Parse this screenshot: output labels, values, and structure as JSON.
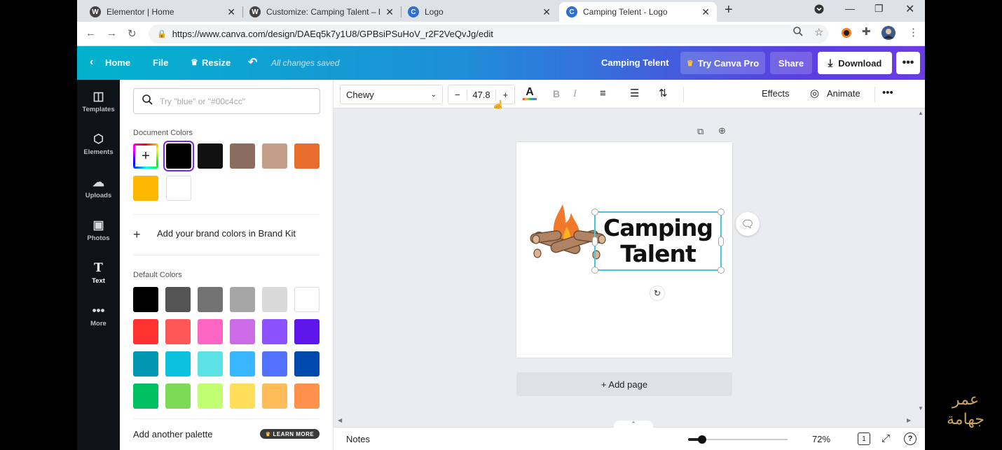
{
  "browser": {
    "tabs": [
      {
        "label": "Elementor | Home",
        "icon": "wordpress-icon"
      },
      {
        "label": "Customize: Camping Talent – Eve",
        "icon": "wordpress-icon"
      },
      {
        "label": "Logo",
        "icon": "canva-icon"
      },
      {
        "label": "Camping Telent - Logo",
        "icon": "canva-icon"
      }
    ],
    "url": "https://www.canva.com/design/DAEq5k7y1U8/GPBsiPSuHoV_r2F2VeQvJg/edit"
  },
  "topbar": {
    "home": "Home",
    "file": "File",
    "resize": "Resize",
    "status": "All changes saved",
    "design_title": "Camping Telent",
    "try_pro": "Try Canva Pro",
    "share": "Share",
    "download": "Download"
  },
  "leftnav": [
    {
      "label": "Templates",
      "icon": "templates-icon"
    },
    {
      "label": "Elements",
      "icon": "elements-icon"
    },
    {
      "label": "Uploads",
      "icon": "uploads-icon"
    },
    {
      "label": "Photos",
      "icon": "photos-icon"
    },
    {
      "label": "Text",
      "icon": "text-icon"
    },
    {
      "label": "More",
      "icon": "more-icon"
    }
  ],
  "panel": {
    "search_placeholder": "Try \"blue\" or \"#00c4cc\"",
    "document_colors_title": "Document Colors",
    "document_colors": [
      "#000000",
      "#111111",
      "#8a6d5e",
      "#c49e86",
      "#e86c2c",
      "#ffb703",
      "#ffffff"
    ],
    "brand_kit": "Add your brand colors in Brand Kit",
    "default_colors_title": "Default Colors",
    "default_colors": [
      [
        "#000000",
        "#545454",
        "#737373",
        "#a6a6a6",
        "#d9d9d9",
        "#ffffff"
      ],
      [
        "#ff3131",
        "#ff5757",
        "#ff66c4",
        "#cb6ce6",
        "#8c52ff",
        "#5e17eb"
      ],
      [
        "#0097b2",
        "#0cc0df",
        "#5ce1e6",
        "#38b6ff",
        "#5271ff",
        "#004aad"
      ],
      [
        "#00bf63",
        "#7ed957",
        "#c1ff72",
        "#ffde59",
        "#ffbd59",
        "#ff914d"
      ]
    ],
    "add_palette": "Add another palette",
    "learn_more": "LEARN MORE"
  },
  "toolbar": {
    "font": "Chewy",
    "size": "47.8",
    "bold": "B",
    "italic": "I",
    "effects": "Effects",
    "animate": "Animate"
  },
  "canvas": {
    "logo_line1": "Camping",
    "logo_line2": "Talent",
    "add_page": "+ Add page"
  },
  "bottombar": {
    "notes": "Notes",
    "zoom": "72%",
    "zoom_fraction": 0.72,
    "page_count": "1"
  },
  "watermark": {
    "line1": "عمر",
    "line2": "جهامة"
  }
}
